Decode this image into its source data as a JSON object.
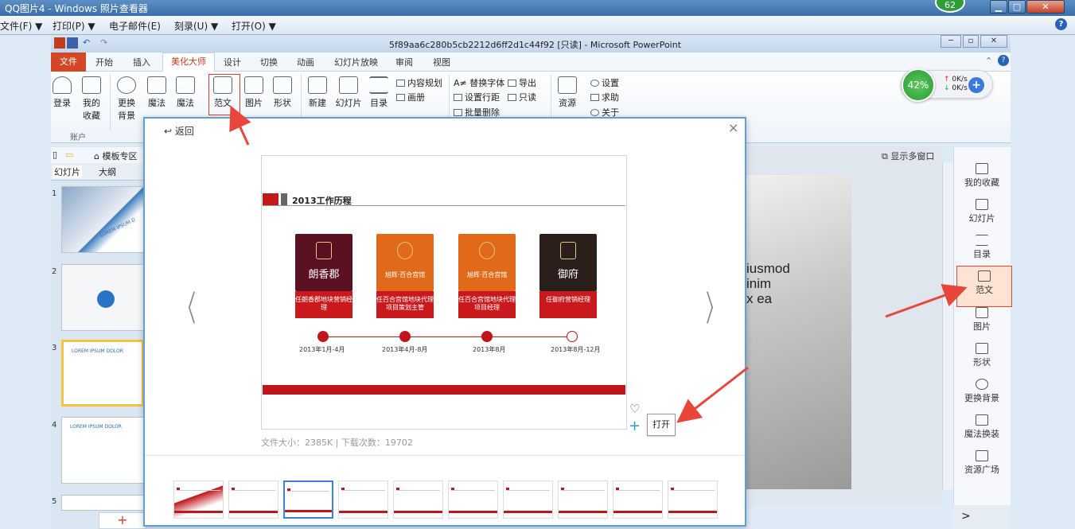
{
  "viewer": {
    "title": "QQ图片4 - Windows 照片查看器",
    "badge": "62",
    "menu": [
      "文件(F) ▼",
      "打印(P) ▼",
      "电子邮件(E)",
      "刻录(U) ▼",
      "打开(O) ▼"
    ],
    "help": "?"
  },
  "ppt": {
    "title": "5f89aa6c280b5cb2212d6ff2d1c44f92 [只读] - Microsoft PowerPoint",
    "tabs": {
      "file": "文件",
      "items": [
        "开始",
        "插入",
        "美化大师",
        "设计",
        "切换",
        "动画",
        "幻灯片放映",
        "审阅",
        "视图"
      ]
    },
    "ribbon": {
      "login": "登录",
      "favorites": [
        "我的",
        "收藏"
      ],
      "change_bg": [
        "更换",
        "背景"
      ],
      "magic1": "魔法",
      "magic2": "魔法",
      "fanwen": "范文",
      "picture": "图片",
      "shape": "形状",
      "new": "新建",
      "slides": "幻灯片",
      "toc": "目录",
      "content_plan": "内容规划",
      "album": "画册",
      "replace_font": "A≠ 替换字体",
      "export": "导出",
      "line_spacing": "设置行距",
      "readonly": "只读",
      "batch_delete": "批量删除",
      "resources": "资源",
      "settings": "设置",
      "help": "求助",
      "about": "关于",
      "group_account": "账户"
    },
    "net": {
      "percent": "42%",
      "up": "0K/s",
      "down": "0K/s"
    }
  },
  "left_panel": {
    "toolbar_label": "模板专区",
    "tabs": [
      "幻灯片",
      "大纲"
    ],
    "slide_numbers": [
      "1",
      "2",
      "3",
      "4",
      "5"
    ],
    "thumb_texts": [
      "LOREM IPSUM D",
      "LOREM IPSUM DOLOR",
      "LOREM IPSUM DOLOR"
    ],
    "add": "+"
  },
  "main": {
    "show_multi": "显示多窗口",
    "text_lines": [
      "iusmod",
      "inim",
      "x ea"
    ]
  },
  "sidebar": {
    "items": [
      "我的收藏",
      "幻灯片",
      "目录",
      "范文",
      "图片",
      "形状",
      "更换背景",
      "魔法换装",
      "资源广场"
    ],
    "expand": ">"
  },
  "dialog": {
    "back": "返回",
    "close": "×",
    "preview_title": "2013工作历程",
    "cards": [
      {
        "name": "朗香郡",
        "color": "#5a1020",
        "caption": "任朗香郡地块营销经理"
      },
      {
        "name": "旭辉·百合宫馆",
        "color": "#e06a1a",
        "caption": "任百合宫馆地块代理项目策划主管"
      },
      {
        "name": "旭辉·百合宫馆",
        "color": "#e06a1a",
        "caption": "任百合宫馆地块代理项目经理"
      },
      {
        "name": "御府",
        "color": "#2a1f1a",
        "caption": "任御府营销经理"
      }
    ],
    "dates": [
      "2013年1月-4月",
      "2013年4月-8月",
      "2013年8月",
      "2013年8月-12月"
    ],
    "open": "打开",
    "file_info": "文件大小：2385K | 下载次数：19702",
    "nav_prev": "〈",
    "nav_next": "〉",
    "strip_count": 10,
    "selected_strip": 3
  },
  "colors": {
    "accent_red": "#c0151a",
    "ribbon_tab": "#d24726",
    "highlight": "#e8463a",
    "dialog_border": "#5fa0d8"
  }
}
